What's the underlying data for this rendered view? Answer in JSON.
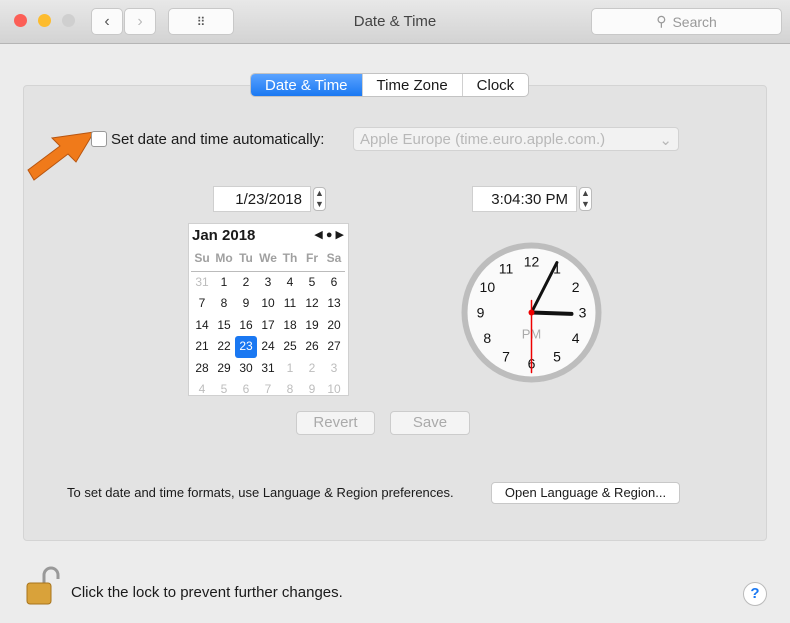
{
  "window": {
    "title": "Date & Time",
    "search_placeholder": "Search"
  },
  "tabs": [
    {
      "label": "Date & Time",
      "active": true
    },
    {
      "label": "Time Zone"
    },
    {
      "label": "Clock"
    }
  ],
  "auto": {
    "label": "Set date and time automatically:",
    "checked": false,
    "server": "Apple Europe (time.euro.apple.com.)"
  },
  "date": "1/23/2018",
  "time": "3:04:30 PM",
  "calendar": {
    "month": "Jan 2018",
    "weekdays": [
      "Su",
      "Mo",
      "Tu",
      "We",
      "Th",
      "Fr",
      "Sa"
    ],
    "days": [
      "31",
      "1",
      "2",
      "3",
      "4",
      "5",
      "6",
      "7",
      "8",
      "9",
      "10",
      "11",
      "12",
      "13",
      "14",
      "15",
      "16",
      "17",
      "18",
      "19",
      "20",
      "21",
      "22",
      "23",
      "24",
      "25",
      "26",
      "27",
      "28",
      "29",
      "30",
      "31",
      "1",
      "2",
      "3",
      "4",
      "5",
      "6",
      "7",
      "8",
      "9",
      "10"
    ],
    "selected": "23"
  },
  "clock": {
    "numbers": [
      "12",
      "1",
      "2",
      "3",
      "4",
      "5",
      "6",
      "7",
      "8",
      "9",
      "10",
      "11"
    ],
    "ampm": "PM",
    "hour": 3,
    "minute": 4,
    "second": 30
  },
  "buttons": {
    "revert": "Revert",
    "save": "Save",
    "open_region": "Open Language & Region..."
  },
  "info_text": "To set date and time formats, use Language & Region preferences.",
  "lock_text": "Click the lock to prevent further changes.",
  "help": "?",
  "colors": {
    "accent": "#1a78f2",
    "arrow": "#f07a1a"
  }
}
